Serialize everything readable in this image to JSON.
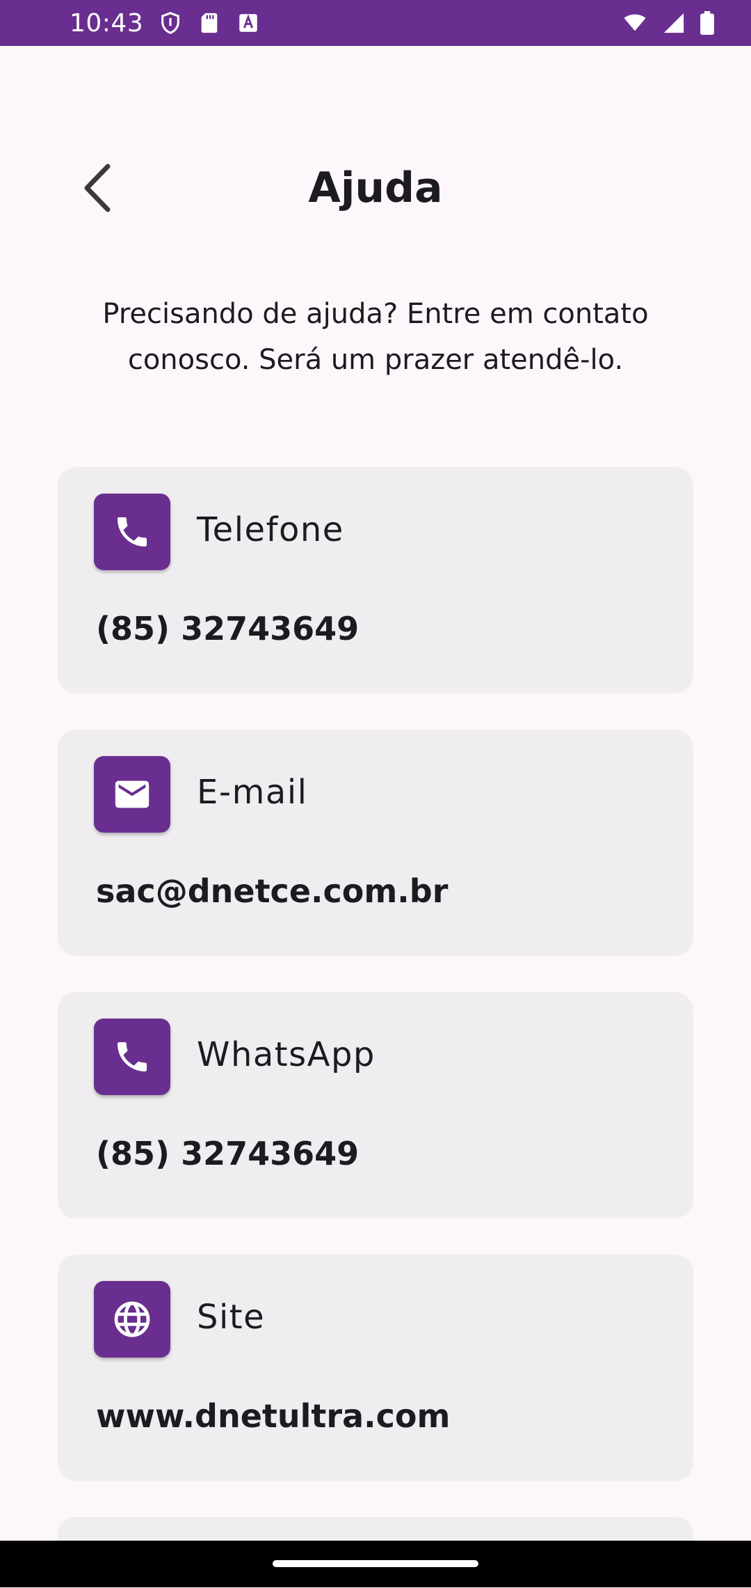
{
  "status_bar": {
    "time": "10:43",
    "icons_left": [
      "shield-icon",
      "sd-card-icon",
      "font-a-icon"
    ],
    "icons_right": [
      "wifi-icon",
      "signal-icon",
      "battery-icon"
    ]
  },
  "header": {
    "title": "Ajuda",
    "back_icon": "chevron-left-icon"
  },
  "intro": {
    "text": "Precisando de ajuda? Entre em contato conosco. Será um prazer atendê-lo."
  },
  "contacts": [
    {
      "label": "Telefone",
      "value": "(85) 32743649",
      "icon": "phone-icon"
    },
    {
      "label": "E-mail",
      "value": "sac@dnetce.com.br",
      "icon": "mail-icon"
    },
    {
      "label": "WhatsApp",
      "value": "(85) 32743649",
      "icon": "phone-icon"
    },
    {
      "label": "Site",
      "value": "www.dnetultra.com",
      "icon": "globe-icon"
    }
  ],
  "colors": {
    "accent": "#692E8F",
    "card_bg": "#EFEDF0",
    "background": "#FDF7FC"
  }
}
